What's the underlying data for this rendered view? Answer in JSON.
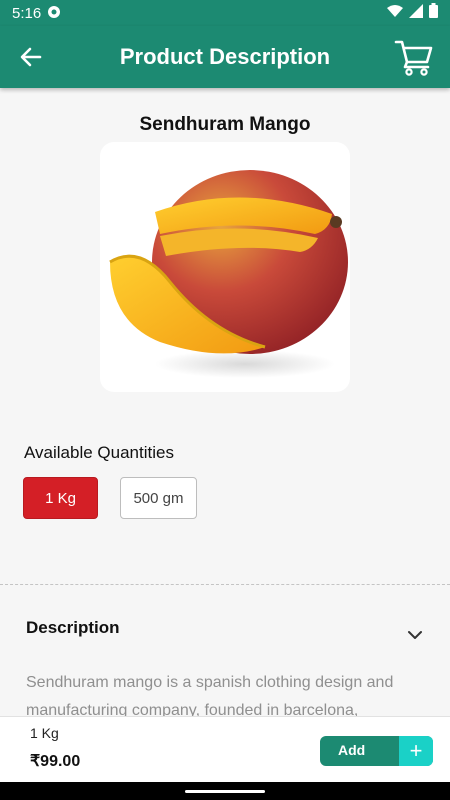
{
  "status_bar": {
    "time": "5:16"
  },
  "app_bar": {
    "title": "Product Description"
  },
  "product": {
    "name": "Sendhuram Mango"
  },
  "quantities": {
    "heading": "Available Quantities",
    "options": [
      {
        "label": "1 Kg",
        "selected": true
      },
      {
        "label": "500 gm",
        "selected": false
      }
    ]
  },
  "description": {
    "heading": "Description",
    "text": "Sendhuram mango is a spanish clothing design and manufacturing company, founded in barcelona,"
  },
  "bottom_bar": {
    "selected_quantity": "1 Kg",
    "price": "₹99.00",
    "add_label": "Add",
    "plus_symbol": "+"
  },
  "colors": {
    "primary": "#1c8a72",
    "selected_quantity": "#d41f26",
    "accent": "#1ad1c7"
  },
  "icons": [
    "message-icon",
    "wifi-icon",
    "signal-icon",
    "battery-icon",
    "back-arrow-icon",
    "cart-icon",
    "chevron-down-icon"
  ]
}
